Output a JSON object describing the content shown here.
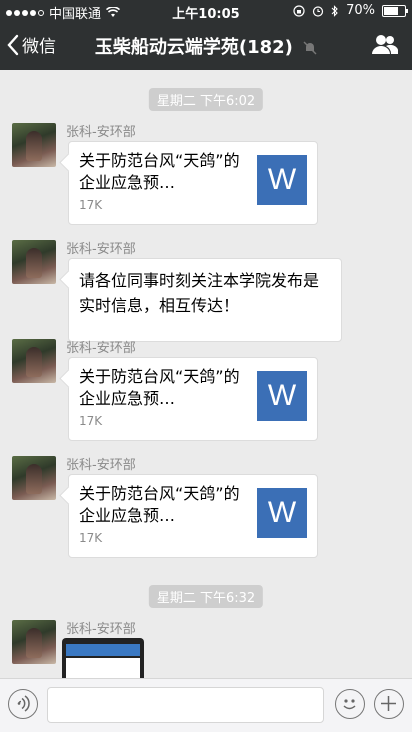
{
  "status_bar": {
    "carrier": "中国联通",
    "time": "上午10:05",
    "battery": "70%"
  },
  "nav": {
    "back_label": "微信",
    "title": "玉柴船动云端学苑(182)"
  },
  "chat": {
    "time_labels": [
      "星期二 下午6:02",
      "星期二 下午6:32"
    ],
    "messages": [
      {
        "sender": "张科-安环部",
        "type": "file",
        "title": "关于防范台风“天鸽”的企业应急预…",
        "size": "17K",
        "icon_letter": "W"
      },
      {
        "sender": "张科-安环部",
        "type": "text",
        "text": "请各位同事时刻关注本学院发布是实时信息，相互传达！"
      },
      {
        "sender": "张科-安环部",
        "type": "file",
        "title": "关于防范台风“天鸽”的企业应急预…",
        "size": "17K",
        "icon_letter": "W"
      },
      {
        "sender": "张科-安环部",
        "type": "file",
        "title": "关于防范台风“天鸽”的企业应急预…",
        "size": "17K",
        "icon_letter": "W"
      },
      {
        "sender": "张科-安环部",
        "type": "image"
      }
    ]
  },
  "input_bar": {
    "placeholder": ""
  },
  "icons": {
    "signal": "signal-dots-icon",
    "wifi": "wifi-icon",
    "lock": "orientation-lock-icon",
    "alarm": "alarm-icon",
    "bluetooth": "bluetooth-icon",
    "battery": "battery-icon",
    "back": "chevron-left-icon",
    "mute": "mute-bell-icon",
    "group": "group-people-icon",
    "voice": "voice-icon",
    "emoji": "emoji-icon",
    "plus": "plus-icon"
  },
  "colors": {
    "header_bg": "#2e3132",
    "chat_bg": "#ebebeb",
    "word_blue": "#3b6fb6"
  }
}
